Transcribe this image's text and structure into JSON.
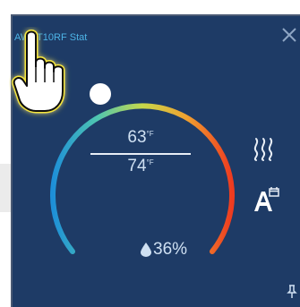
{
  "window": {
    "title": "AWRT10RF Stat"
  },
  "thermostat": {
    "heat_setpoint": "63",
    "cool_setpoint": "74",
    "unit": "°F",
    "humidity": "36%",
    "mode": "heat",
    "schedule": "auto"
  },
  "icons": {
    "close": "close-icon",
    "heat": "heat-icon",
    "auto_schedule": "auto-schedule-icon",
    "humidity": "water-drop-icon",
    "pin": "pin-icon",
    "cursor": "hand-pointer-icon"
  },
  "colors": {
    "panel_bg": "#1e3b66",
    "title": "#4db3e6",
    "text": "#cfe0f2",
    "dial_start": "#1e8fd8",
    "dial_mid": "#c7d84a",
    "dial_end": "#ee3b20"
  }
}
